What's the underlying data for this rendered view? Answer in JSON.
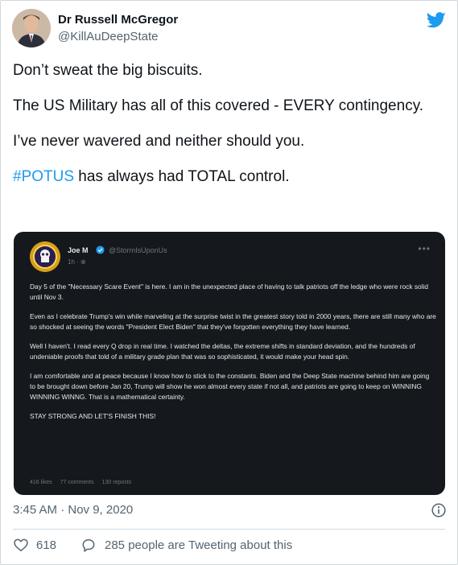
{
  "author": {
    "name": "Dr Russell McGregor",
    "handle": "@KillAuDeepState"
  },
  "tweet": {
    "lines": [
      "Don’t sweat the big biscuits.",
      "The US Military has all of this covered - EVERY contingency.",
      "I’ve never wavered and neither should you."
    ],
    "hashtag": "#POTUS",
    "last_line_rest": " has always had TOTAL control."
  },
  "embed": {
    "name": "Joe M",
    "handle": "@StormIsUponUs",
    "time": "1h",
    "paragraphs": [
      "Day 5 of the \"Necessary Scare Event\" is here. I am in the unexpected place of having to talk patriots off the ledge who were rock solid until Nov 3.",
      "Even as I celebrate Trump's win while marveling at the surprise twist in the greatest story told in 2000 years, there are still many who are so shocked at seeing the words \"President Elect Biden\" that they've forgotten everything they have learned.",
      "Well I haven't. I read every Q drop in real time. I watched the deltas, the extreme shifts in standard deviation, and the hundreds of undeniable proofs that told of a military grade plan that was so sophisticated, it would make your head spin.",
      "I am comfortable and at peace because I know how to stick to the constants. Biden and the Deep State machine behind him are going to be brought down before Jan 20, Trump will show he won almost every state if not all, and patriots are going to keep on WINNING WINNING WINNG. That is a mathematical certainty.",
      "STAY STRONG AND LET'S FINISH THIS!"
    ],
    "likes": "416 likes",
    "comments": "77 comments",
    "reposts": "130 reposts"
  },
  "footer": {
    "timestamp": "3:45 AM · Nov 9, 2020",
    "like_count": "618",
    "tweeting_text": "285 people are Tweeting about this"
  },
  "colors": {
    "accent": "#1d9bf0",
    "embed_bg": "#15181c",
    "muted": "#536471"
  }
}
